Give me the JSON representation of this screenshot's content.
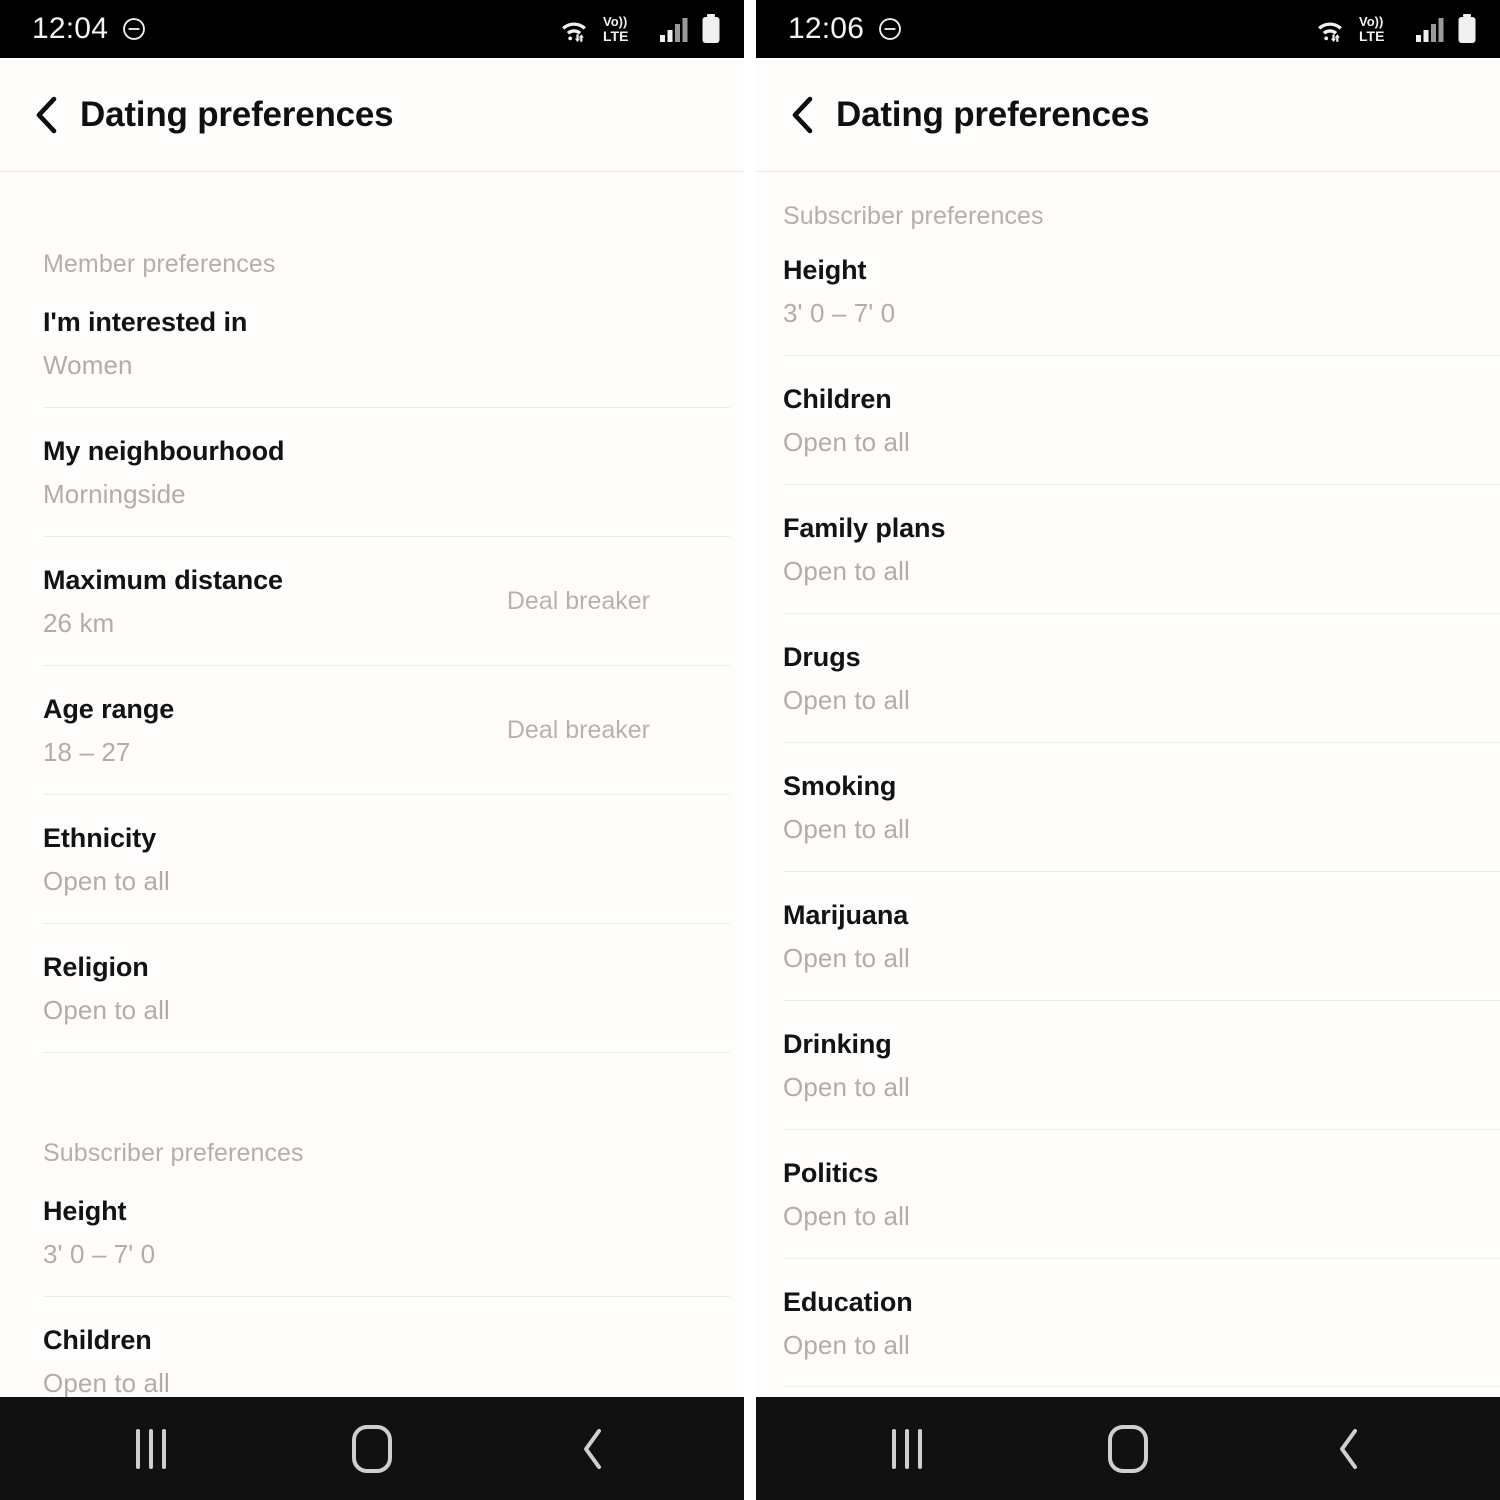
{
  "screens": [
    {
      "status": {
        "time": "12:04",
        "dnd_icon": "do-not-disturb-icon",
        "wifi_icon": "wifi-icon",
        "volte_top": "Vo))",
        "volte_bottom": "LTE",
        "signal_icon": "signal-bars-icon",
        "battery_icon": "battery-icon"
      },
      "appbar": {
        "back_icon": "back-chevron-icon",
        "title": "Dating preferences"
      },
      "sections": [
        {
          "heading": "Member preferences",
          "rows": [
            {
              "label": "I'm interested in",
              "value": "Women",
              "aside": ""
            },
            {
              "label": "My neighbourhood",
              "value": "Morningside",
              "aside": ""
            },
            {
              "label": "Maximum distance",
              "value": "26 km",
              "aside": "Deal breaker"
            },
            {
              "label": "Age range",
              "value": "18 – 27",
              "aside": "Deal breaker"
            },
            {
              "label": "Ethnicity",
              "value": "Open to all",
              "aside": ""
            },
            {
              "label": "Religion",
              "value": "Open to all",
              "aside": ""
            }
          ]
        },
        {
          "heading": "Subscriber preferences",
          "rows": [
            {
              "label": "Height",
              "value": "3' 0 – 7' 0",
              "aside": ""
            },
            {
              "label": "Children",
              "value": "Open to all",
              "aside": ""
            }
          ]
        }
      ],
      "nav": {
        "recents": "recent-apps-button",
        "home": "home-button",
        "back": "back-button"
      }
    },
    {
      "status": {
        "time": "12:06",
        "dnd_icon": "do-not-disturb-icon",
        "wifi_icon": "wifi-icon",
        "volte_top": "Vo))",
        "volte_bottom": "LTE",
        "signal_icon": "signal-bars-icon",
        "battery_icon": "battery-icon"
      },
      "appbar": {
        "back_icon": "back-chevron-icon",
        "title": "Dating preferences"
      },
      "sections": [
        {
          "heading": "Subscriber preferences",
          "rows": [
            {
              "label": "Height",
              "value": "3' 0 – 7' 0",
              "aside": ""
            },
            {
              "label": "Children",
              "value": "Open to all",
              "aside": ""
            },
            {
              "label": "Family plans",
              "value": "Open to all",
              "aside": ""
            },
            {
              "label": "Drugs",
              "value": "Open to all",
              "aside": ""
            },
            {
              "label": "Smoking",
              "value": "Open to all",
              "aside": ""
            },
            {
              "label": "Marijuana",
              "value": "Open to all",
              "aside": ""
            },
            {
              "label": "Drinking",
              "value": "Open to all",
              "aside": ""
            },
            {
              "label": "Politics",
              "value": "Open to all",
              "aside": ""
            },
            {
              "label": "Education",
              "value": "Open to all",
              "aside": ""
            }
          ]
        }
      ],
      "nav": {
        "recents": "recent-apps-button",
        "home": "home-button",
        "back": "back-button"
      }
    }
  ],
  "colors": {
    "background": "#FEFDFB",
    "statusbar": "#000000",
    "navbar": "#111111",
    "label": "#131313",
    "muted": "#b0adaa",
    "divider": "#ececea"
  }
}
